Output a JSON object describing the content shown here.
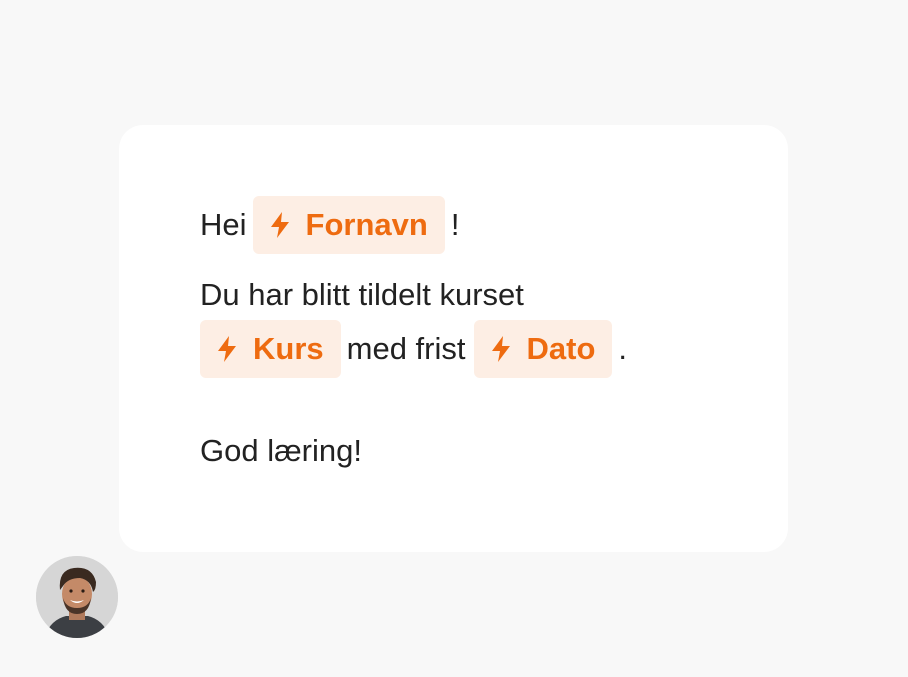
{
  "message": {
    "greeting": "Hei",
    "first_name_chip": "Fornavn",
    "exclamation": "!",
    "assigned_text": "Du har blitt tildelt kurset",
    "course_chip": "Kurs",
    "deadline_text": "med frist",
    "date_chip": "Dato",
    "period": ".",
    "closing": "God læring!"
  },
  "icons": {
    "chip_icon": "lightning-bolt-icon",
    "avatar": "user-avatar"
  },
  "colors": {
    "background": "#f8f8f8",
    "bubble": "#ffffff",
    "chip_background": "#fdeee4",
    "chip_text": "#ee6b10",
    "text": "#222222"
  }
}
